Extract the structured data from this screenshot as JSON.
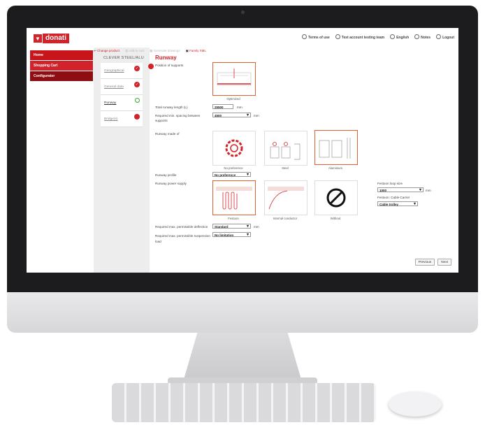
{
  "header": {
    "logo_text": "donati",
    "nav": [
      "Terms of use",
      "Test account testing team",
      "English",
      "Notes",
      "Logout"
    ]
  },
  "sidebar": {
    "items": [
      {
        "label": "Home"
      },
      {
        "label": "Shopping Cart"
      },
      {
        "label": "Configurator"
      }
    ]
  },
  "actions": {
    "change_product": "Change product",
    "add_to_cart": "Add to cart",
    "generate_drawings": "Generate drawings",
    "family_xml": "Family XML"
  },
  "product": {
    "title": "CLEVER STEEL/ALU"
  },
  "steps": [
    {
      "label": "Geographical",
      "status": "done"
    },
    {
      "label": "General data",
      "status": "done"
    },
    {
      "label": "Runway",
      "status": "active"
    },
    {
      "label": "Bridge(s)",
      "status": "pending"
    }
  ],
  "page": {
    "title": "Runway"
  },
  "form": {
    "position_of_supports_label": "Position of supports",
    "position_option": "Optimized",
    "total_length_label": "Total runway length (L)",
    "total_length_value": "25500",
    "total_length_unit": "mm",
    "spacing_label": "Required min. spacing between supports",
    "spacing_value": "4500",
    "spacing_unit": "mm",
    "runway_made_of_label": "Runway made of",
    "material_options": [
      "No preference",
      "Steel",
      "Aluminium"
    ],
    "runway_profile_label": "Runway profile",
    "runway_profile_value": "No preference",
    "power_supply_label": "Runway power supply",
    "power_options": [
      "Festoon",
      "Internal conductor",
      "Without"
    ],
    "festoon_loop_label": "Festoon loop size",
    "festoon_loop_value": "1000",
    "festoon_loop_unit": "mm",
    "festoon_cable_label": "Festoon: Cable Carrier",
    "festoon_cable_value": "Cable trolley",
    "deflection_label": "Required max. permissible deflection",
    "deflection_value": "Standard",
    "deflection_unit": "mm",
    "suspension_label": "Required max. permissible suspension load",
    "suspension_value": "No limitation"
  },
  "buttons": {
    "previous": "Previous",
    "next": "Next"
  },
  "colors": {
    "brand_red": "#d2232a",
    "selected_border": "#e06030",
    "step_done": "#d2232a",
    "step_open": "#3aaa35"
  }
}
